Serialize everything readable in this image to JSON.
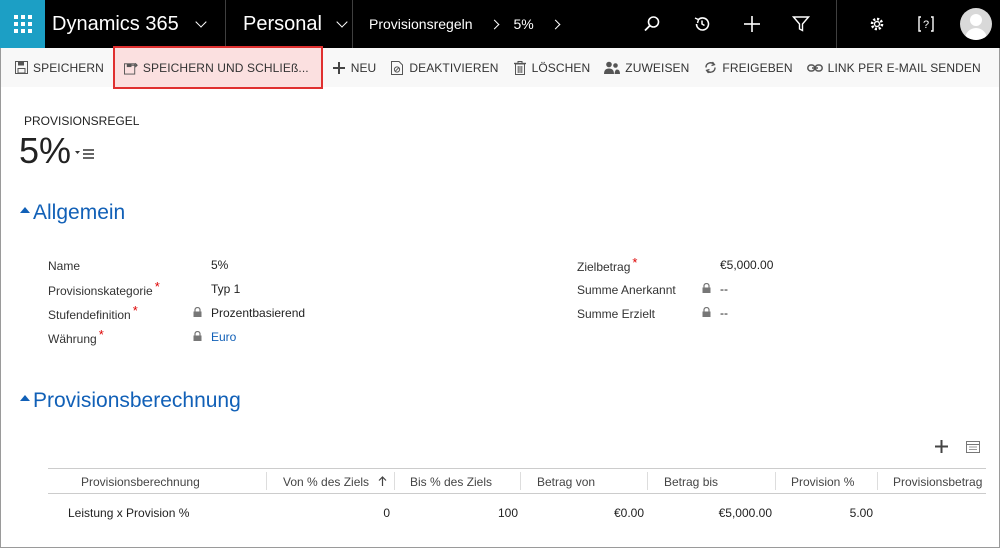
{
  "topnav": {
    "brand": "Dynamics 365",
    "area": "Personal",
    "breadcrumb": [
      "Provisionsregeln",
      "5%"
    ]
  },
  "commandbar": {
    "items": [
      {
        "label": "SPEICHERN",
        "icon": "save-icon"
      },
      {
        "label": "SPEICHERN UND SCHLIEß...",
        "icon": "save-close-icon"
      },
      {
        "label": "NEU",
        "icon": "plus-icon"
      },
      {
        "label": "DEAKTIVIEREN",
        "icon": "deactivate-icon"
      },
      {
        "label": "LÖSCHEN",
        "icon": "trash-icon"
      },
      {
        "label": "ZUWEISEN",
        "icon": "assign-icon"
      },
      {
        "label": "FREIGEBEN",
        "icon": "share-icon"
      },
      {
        "label": "LINK PER E-MAIL SENDEN",
        "icon": "link-icon"
      }
    ],
    "more": "•••"
  },
  "header": {
    "entity_type": "PROVISIONSREGEL",
    "record_name": "5%"
  },
  "general": {
    "title": "Allgemein",
    "left_fields": [
      {
        "label": "Name",
        "value": "5%",
        "required": false,
        "locked": false
      },
      {
        "label": "Provisionskategorie",
        "value": "Typ 1",
        "required": true,
        "locked": false
      },
      {
        "label": "Stufendefinition",
        "value": "Prozentbasierend",
        "required": true,
        "locked": true
      },
      {
        "label": "Währung",
        "value": "Euro",
        "required": true,
        "locked": true
      }
    ],
    "right_fields": [
      {
        "label": "Zielbetrag",
        "value": "€5,000.00",
        "required": true,
        "locked": false
      },
      {
        "label": "Summe Anerkannt",
        "value": "--",
        "required": false,
        "locked": true
      },
      {
        "label": "Summe Erzielt",
        "value": "--",
        "required": false,
        "locked": true
      }
    ]
  },
  "calculation": {
    "title": "Provisionsberechnung",
    "columns": [
      "Provisionsberechnung",
      "Von % des Ziels",
      "Bis % des Ziels",
      "Betrag von",
      "Betrag bis",
      "Provision %",
      "Provisionsbetrag"
    ],
    "rows": [
      [
        "Leistung x Provision %",
        "0",
        "100",
        "€0.00",
        "€5,000.00",
        "5.00",
        ""
      ]
    ]
  },
  "colors": {
    "accent": "#1160b7",
    "waffle": "#1c9fc5",
    "highlight_border": "#e03030",
    "required": "#dd0000"
  }
}
